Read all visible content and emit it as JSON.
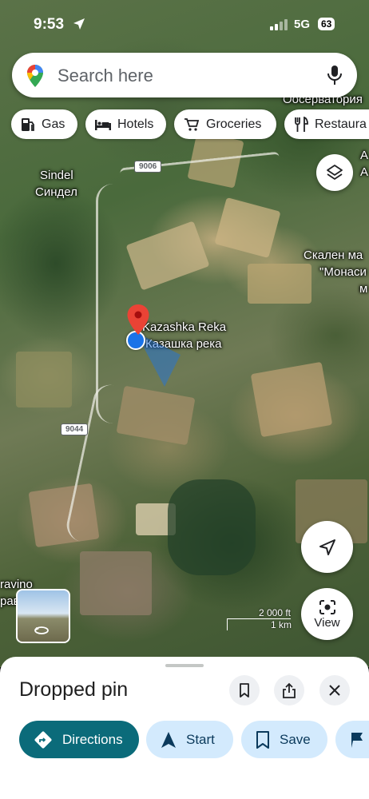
{
  "status_bar": {
    "time": "9:53",
    "network": "5G",
    "battery": "63"
  },
  "search": {
    "placeholder": "Search here"
  },
  "chips": [
    {
      "label": "Gas",
      "icon": "gas-station-icon"
    },
    {
      "label": "Hotels",
      "icon": "bed-icon"
    },
    {
      "label": "Groceries",
      "icon": "cart-icon"
    },
    {
      "label": "Restaura",
      "icon": "restaurant-icon"
    }
  ],
  "map": {
    "labels": {
      "sindel_latin": "Sindel",
      "sindel_cyrillic": "Синдел",
      "pin_latin": "Kazashka Reka",
      "pin_cyrillic": "Казашка река",
      "top_right": "Оосерватория",
      "right_a1": "А",
      "right_a2": "А",
      "skalen": "Скален ма",
      "monas": "\"Монаси",
      "monas_m": "м",
      "bottom_left1": "ravino",
      "bottom_left2": "рав"
    },
    "roads": [
      "9006",
      "9044"
    ],
    "scale": {
      "ft": "2 000 ft",
      "km": "1 km"
    }
  },
  "controls": {
    "view_label": "View"
  },
  "sheet": {
    "title": "Dropped pin",
    "actions": [
      {
        "label": "Directions",
        "icon": "directions-icon"
      },
      {
        "label": "Start",
        "icon": "navigation-arrow-icon"
      },
      {
        "label": "Save",
        "icon": "bookmark-icon"
      },
      {
        "label": "",
        "icon": "flag-icon"
      }
    ]
  },
  "colors": {
    "accent": "#0b6b7a",
    "action_bg": "#d3eafd",
    "pin_red": "#ea4335",
    "location_blue": "#1a73e8"
  }
}
